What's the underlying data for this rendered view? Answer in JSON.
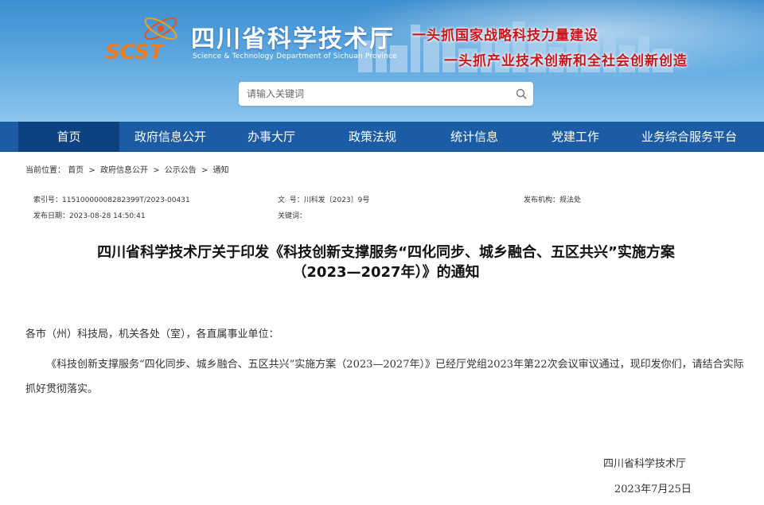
{
  "header": {
    "logo_text": "SCST",
    "site_title": "四川省科学技术厅",
    "site_subtitle": "Science & Technology Department of Sichuan Province",
    "slogan_line1": "一头抓国家战略科技力量建设",
    "slogan_line2": "一头抓产业技术创新和全社会创新创造"
  },
  "search": {
    "placeholder": "请输入关键词"
  },
  "nav": {
    "items": [
      {
        "label": "首页"
      },
      {
        "label": "政府信息公开"
      },
      {
        "label": "办事大厅"
      },
      {
        "label": "政策法规"
      },
      {
        "label": "统计信息"
      },
      {
        "label": "党建工作"
      },
      {
        "label": "业务综合服务平台"
      }
    ]
  },
  "breadcrumb": {
    "prefix": "当前位置：",
    "items": [
      "首页",
      "政府信息公开",
      "公示公告",
      "通知"
    ],
    "separator": ">"
  },
  "meta": {
    "index_label": "索引号：",
    "index_value": "11510000008282399T/2023-00431",
    "doc_no_label": "文  号：",
    "doc_no_value": "川科发〔2023〕9号",
    "publisher_label": "发布机构：",
    "publisher_value": "规法处",
    "date_label": "发布日期：",
    "date_value": "2023-08-28 14:50:41",
    "keywords_label": "关键词：",
    "keywords_value": ""
  },
  "article": {
    "title_line1": "四川省科学技术厅关于印发《科技创新支撑服务“四化同步、城乡融合、五区共兴”实施方案",
    "title_line2": "（2023—2027年）》的通知",
    "greeting": "各市（州）科技局，机关各处（室），各直属事业单位：",
    "paragraph": "《科技创新支撑服务“四化同步、城乡融合、五区共兴”实施方案（2023—2027年）》已经厅党组2023年第22次会议审议通过，现印发你们，请结合实际抓好贯彻落实。",
    "signature": "四川省科学技术厅",
    "sign_date": "2023年7月25日"
  },
  "colors": {
    "nav_bg": "#1b5ca5",
    "nav_active": "#0e4182",
    "slogan_red": "#c7161d"
  }
}
